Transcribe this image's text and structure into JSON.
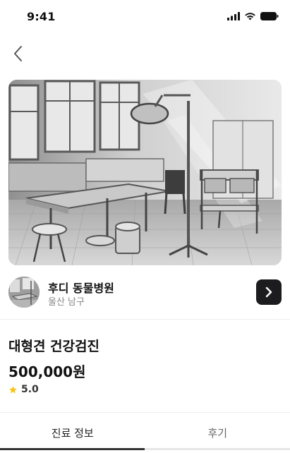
{
  "status_bar": {
    "time": "9:41",
    "icons": [
      "signal-icon",
      "wifi-icon",
      "battery-icon"
    ]
  },
  "nav": {
    "back_icon": "chevron-left-icon"
  },
  "hero_image": {
    "subject": "veterinary operating room photo"
  },
  "hospital": {
    "name": "후디 동물병원",
    "location": "울산 남구",
    "go_icon": "chevron-right-icon"
  },
  "product": {
    "title": "대형견 건강검진",
    "price": "500,000원",
    "rating": "5.0",
    "rating_icon": "star-icon"
  },
  "tabs": [
    {
      "label": "진료 정보",
      "active": true
    },
    {
      "label": "후기",
      "active": false
    }
  ],
  "colors": {
    "accent_dark": "#1c1c1e",
    "star": "#f5c518",
    "divider": "#eeeeee"
  }
}
